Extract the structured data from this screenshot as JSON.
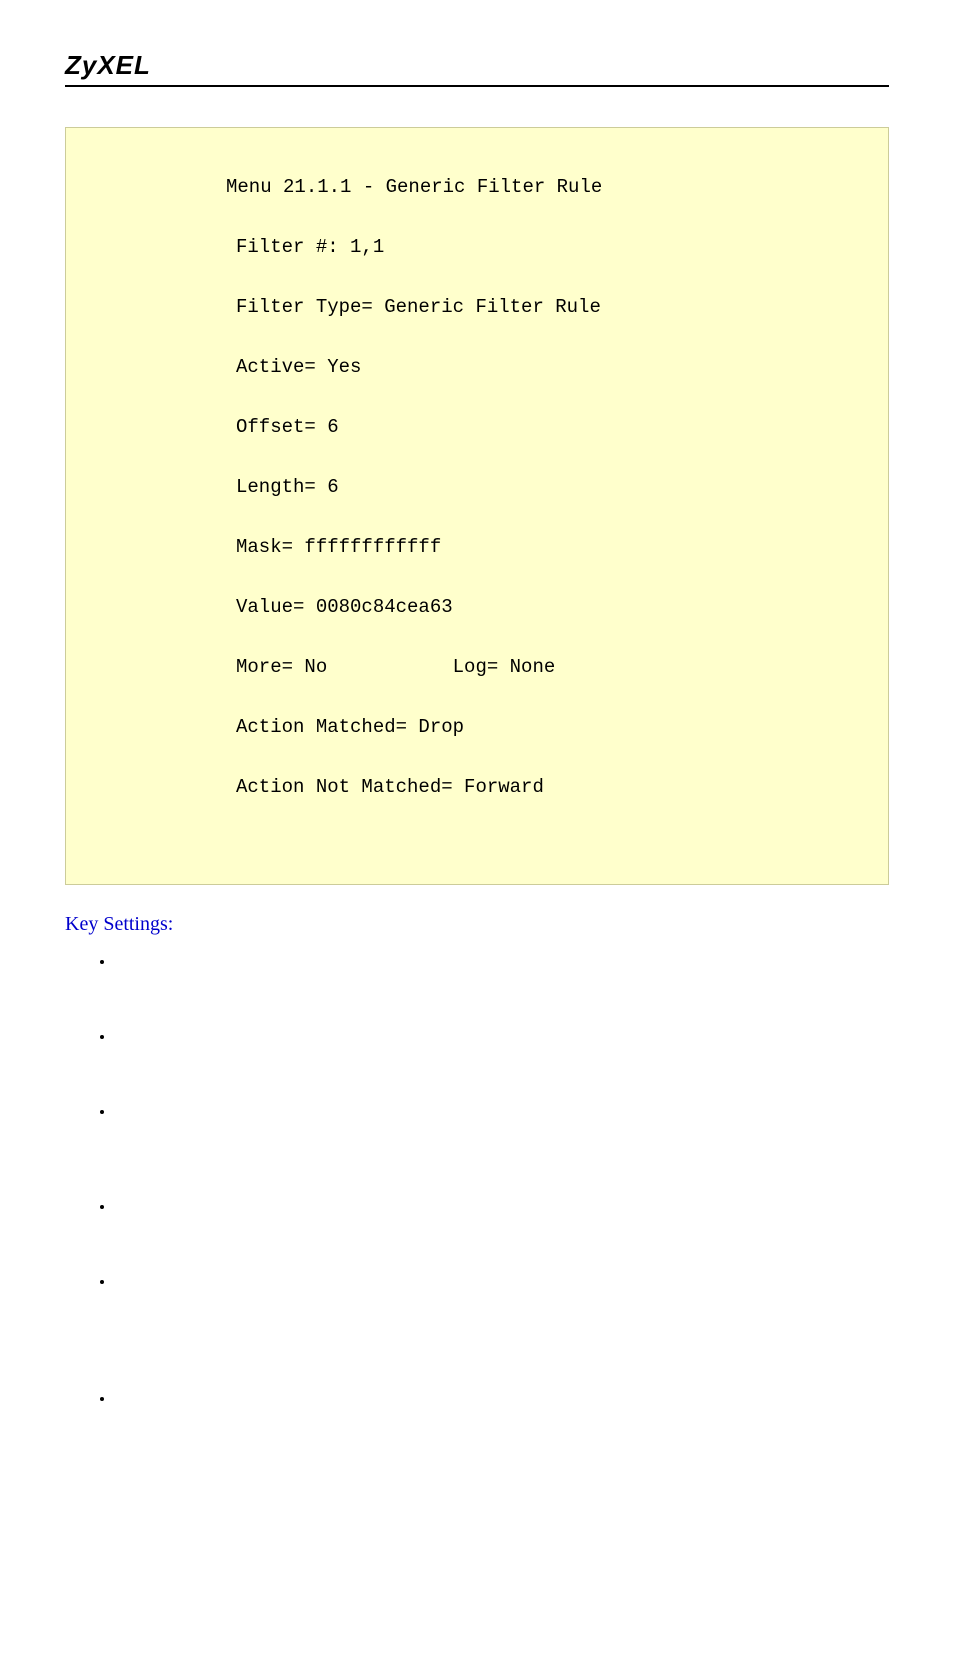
{
  "header": {
    "logo_text": "ZyXEL"
  },
  "code": {
    "title": "Menu 21.1.1 - Generic Filter Rule",
    "filter_no": "Filter #: 1,1",
    "filter_type": "Filter Type= Generic Filter Rule",
    "active": "Active= Yes",
    "offset": "Offset= 6",
    "length": "Length= 6",
    "mask": "Mask= ffffffffffff",
    "value": "Value= 0080c84cea63",
    "more_log": "More= No           Log= None",
    "action_matched": "Action Matched= Drop",
    "action_not_matched": "Action Not Matched= Forward"
  },
  "section_heading": "Key Settings:",
  "bullets": {
    "b1": "",
    "b2": "",
    "b3": "",
    "b4": "",
    "b5": "",
    "b6": ""
  }
}
